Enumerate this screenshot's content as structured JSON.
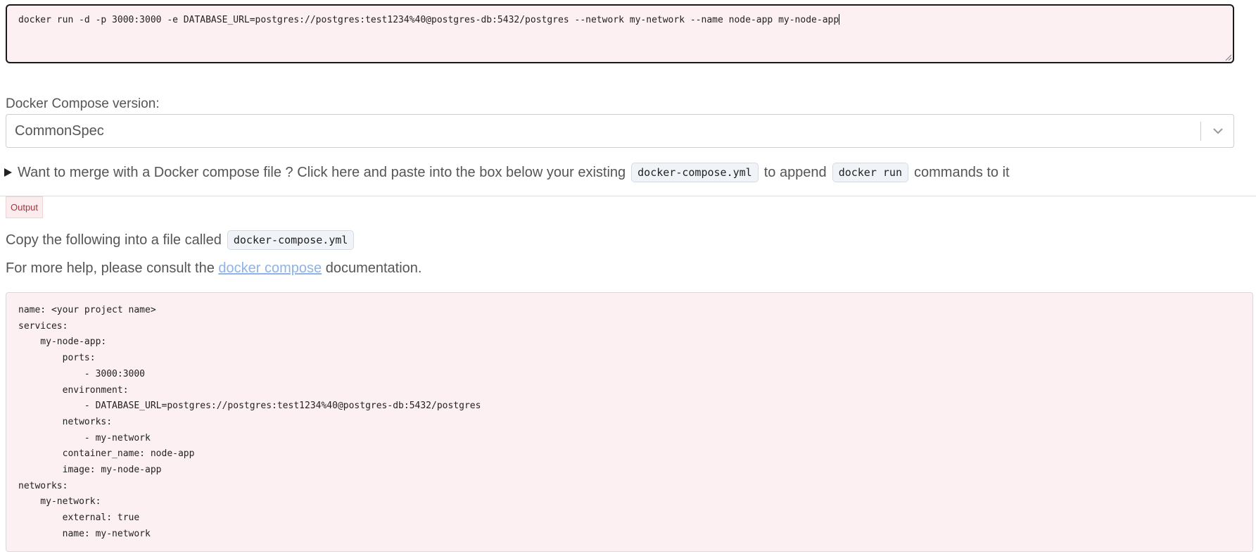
{
  "command_input": {
    "value": "docker run -d -p 3000:3000 -e DATABASE_URL=postgres://postgres:test1234%40@postgres-db:5432/postgres --network my-network --name node-app my-node-app"
  },
  "compose_version": {
    "label": "Docker Compose version:",
    "selected": "CommonSpec"
  },
  "merge": {
    "text_before": "Want to merge with a Docker compose file ? Click here and paste into the box below your existing",
    "code_file": "docker-compose.yml",
    "text_middle": "to append",
    "code_cmd": "docker run",
    "text_after": "commands to it"
  },
  "output": {
    "badge": "Output",
    "copy_text": "Copy the following into a file called",
    "copy_file": "docker-compose.yml",
    "help_before": "For more help, please consult the",
    "help_link": "docker compose",
    "help_after": "documentation.",
    "yaml": "name: <your project name>\nservices:\n    my-node-app:\n        ports:\n            - 3000:3000\n        environment:\n            - DATABASE_URL=postgres://postgres:test1234%40@postgres-db:5432/postgres\n        networks:\n            - my-network\n        container_name: node-app\n        image: my-node-app\nnetworks:\n    my-network:\n        external: true\n        name: my-network"
  },
  "icons": {
    "select_chevron": "chevron-down-icon",
    "merge_toggle": "triangle-right-icon",
    "resize": "resize-grip-icon"
  },
  "colors": {
    "input_bg": "#fdf0f3",
    "link": "#8fb3e6",
    "badge_text": "#9b3a45"
  }
}
